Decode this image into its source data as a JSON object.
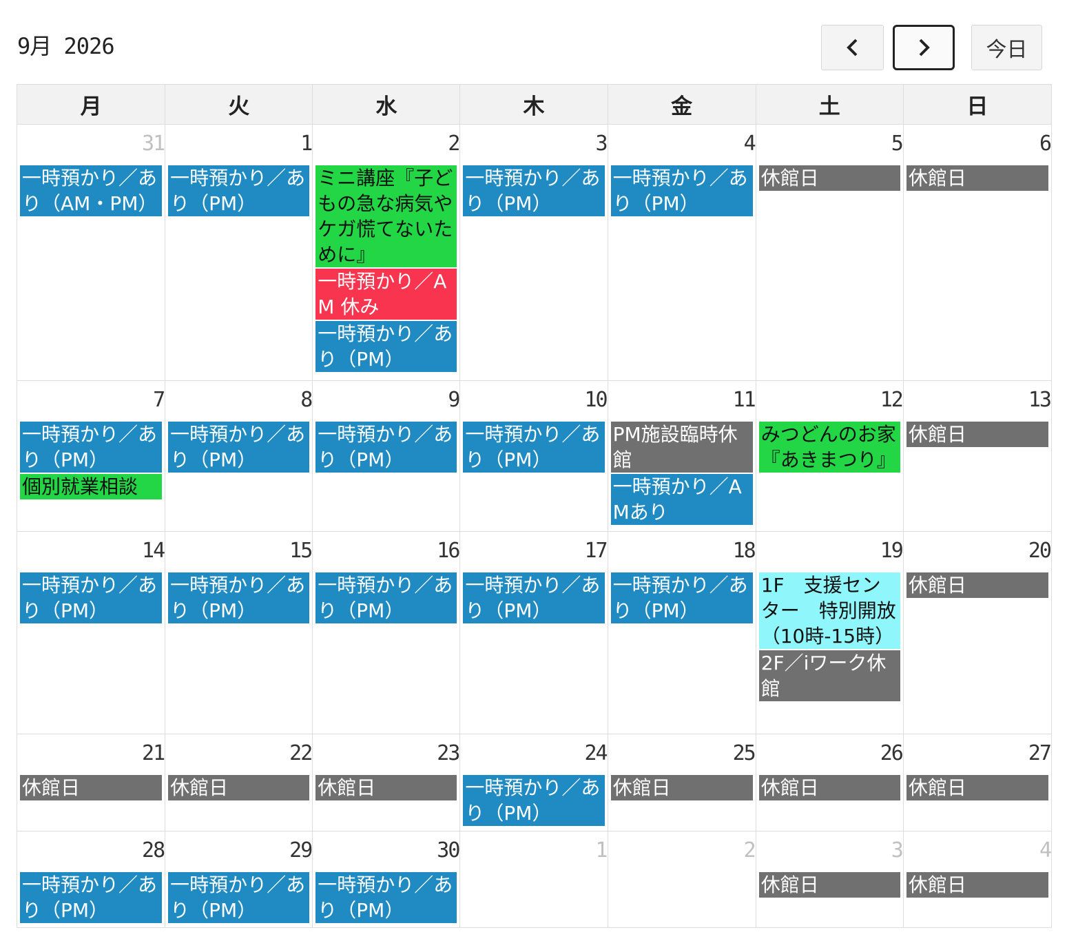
{
  "header": {
    "title": "9月 2026",
    "prev_icon": "chevron-left-icon",
    "next_icon": "chevron-right-icon",
    "today_label": "今日"
  },
  "weekdays": [
    "月",
    "火",
    "水",
    "木",
    "金",
    "土",
    "日"
  ],
  "colors": {
    "blue": "#1f8bc2",
    "gray": "#707070",
    "green": "#22d645",
    "red": "#f9344e",
    "cyan": "#8ff6fb"
  },
  "weeks": [
    {
      "days": [
        {
          "day": "31",
          "other": true,
          "events": [
            {
              "text": "一時預かり／あり（AM・PM）",
              "color": "blue"
            }
          ]
        },
        {
          "day": "1",
          "events": [
            {
              "text": "一時預かり／あり（PM）",
              "color": "blue"
            }
          ]
        },
        {
          "day": "2",
          "events": [
            {
              "text": "ミニ講座『子どもの急な病気やケガ慌てないために』",
              "color": "green"
            },
            {
              "text": "一時預かり／AM 休み",
              "color": "red"
            },
            {
              "text": "一時預かり／あり（PM）",
              "color": "blue"
            }
          ]
        },
        {
          "day": "3",
          "events": [
            {
              "text": "一時預かり／あり（PM）",
              "color": "blue"
            }
          ]
        },
        {
          "day": "4",
          "events": [
            {
              "text": "一時預かり／あり（PM）",
              "color": "blue"
            }
          ]
        },
        {
          "day": "5",
          "events": [
            {
              "text": "休館日",
              "color": "gray"
            }
          ]
        },
        {
          "day": "6",
          "events": [
            {
              "text": "休館日",
              "color": "gray"
            }
          ]
        }
      ]
    },
    {
      "days": [
        {
          "day": "7",
          "events": [
            {
              "text": "一時預かり／あり（PM）",
              "color": "blue"
            },
            {
              "text": "個別就業相談",
              "color": "green"
            }
          ]
        },
        {
          "day": "8",
          "events": [
            {
              "text": "一時預かり／あり（PM）",
              "color": "blue"
            }
          ]
        },
        {
          "day": "9",
          "events": [
            {
              "text": "一時預かり／あり（PM）",
              "color": "blue"
            }
          ]
        },
        {
          "day": "10",
          "events": [
            {
              "text": "一時預かり／あり（PM）",
              "color": "blue"
            }
          ]
        },
        {
          "day": "11",
          "events": [
            {
              "text": "PM施設臨時休館",
              "color": "gray"
            },
            {
              "text": "一時預かり／AMあり",
              "color": "blue"
            }
          ]
        },
        {
          "day": "12",
          "events": [
            {
              "text": "みつどんのお家『あきまつり』",
              "color": "green"
            }
          ]
        },
        {
          "day": "13",
          "events": [
            {
              "text": "休館日",
              "color": "gray"
            }
          ]
        }
      ]
    },
    {
      "days": [
        {
          "day": "14",
          "events": [
            {
              "text": "一時預かり／あり（PM）",
              "color": "blue"
            }
          ]
        },
        {
          "day": "15",
          "events": [
            {
              "text": "一時預かり／あり（PM）",
              "color": "blue"
            }
          ]
        },
        {
          "day": "16",
          "events": [
            {
              "text": "一時預かり／あり（PM）",
              "color": "blue"
            }
          ]
        },
        {
          "day": "17",
          "events": [
            {
              "text": "一時預かり／あり（PM）",
              "color": "blue"
            }
          ]
        },
        {
          "day": "18",
          "events": [
            {
              "text": "一時預かり／あり（PM）",
              "color": "blue"
            }
          ]
        },
        {
          "day": "19",
          "events": [
            {
              "text": "1F　支援センター　特別開放（10時-15時）",
              "color": "cyan"
            },
            {
              "text": "2F／iワーク休館",
              "color": "gray"
            }
          ]
        },
        {
          "day": "20",
          "events": [
            {
              "text": "休館日",
              "color": "gray"
            }
          ]
        }
      ]
    },
    {
      "days": [
        {
          "day": "21",
          "events": [
            {
              "text": "休館日",
              "color": "gray"
            }
          ]
        },
        {
          "day": "22",
          "events": [
            {
              "text": "休館日",
              "color": "gray"
            }
          ]
        },
        {
          "day": "23",
          "events": [
            {
              "text": "休館日",
              "color": "gray"
            }
          ]
        },
        {
          "day": "24",
          "events": [
            {
              "text": "一時預かり／あり（PM）",
              "color": "blue"
            }
          ]
        },
        {
          "day": "25",
          "events": [
            {
              "text": "休館日",
              "color": "gray"
            }
          ]
        },
        {
          "day": "26",
          "events": [
            {
              "text": "休館日",
              "color": "gray"
            }
          ]
        },
        {
          "day": "27",
          "events": [
            {
              "text": "休館日",
              "color": "gray"
            }
          ]
        }
      ]
    },
    {
      "days": [
        {
          "day": "28",
          "events": [
            {
              "text": "一時預かり／あり（PM）",
              "color": "blue"
            }
          ]
        },
        {
          "day": "29",
          "events": [
            {
              "text": "一時預かり／あり（PM）",
              "color": "blue"
            }
          ]
        },
        {
          "day": "30",
          "events": [
            {
              "text": "一時預かり／あり（PM）",
              "color": "blue"
            }
          ]
        },
        {
          "day": "1",
          "other": true,
          "events": []
        },
        {
          "day": "2",
          "other": true,
          "events": []
        },
        {
          "day": "3",
          "other": true,
          "events": [
            {
              "text": "休館日",
              "color": "gray"
            }
          ]
        },
        {
          "day": "4",
          "other": true,
          "events": [
            {
              "text": "休館日",
              "color": "gray"
            }
          ]
        }
      ]
    }
  ]
}
